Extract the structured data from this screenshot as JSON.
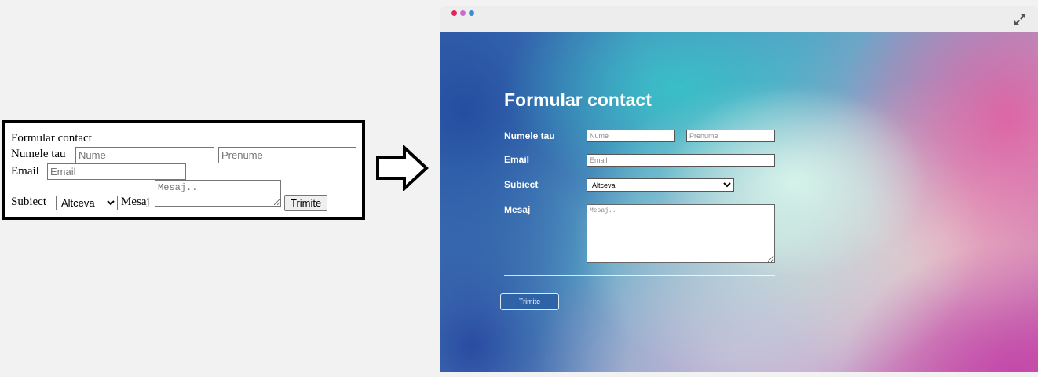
{
  "before": {
    "title": "Formular contact",
    "name_label": "Numele tau",
    "first_name_placeholder": "Nume",
    "last_name_placeholder": "Prenume",
    "email_label": "Email",
    "email_placeholder": "Email",
    "subject_label": "Subiect",
    "subject_selected": "Altceva",
    "message_label": "Mesaj",
    "message_placeholder": "Mesaj..",
    "submit_label": "Trimite"
  },
  "arrow_icon": "right-arrow-icon",
  "window": {
    "traffic_lights": [
      "#e0245e",
      "#c86bd1",
      "#3d8ccb"
    ],
    "expand_icon": "expand-icon"
  },
  "after": {
    "title": "Formular contact",
    "name_label": "Numele tau",
    "first_name_placeholder": "Nume",
    "last_name_placeholder": "Prenume",
    "email_label": "Email",
    "email_placeholder": "Email",
    "subject_label": "Subiect",
    "subject_selected": "Altceva",
    "message_label": "Mesaj",
    "message_placeholder": "Mesaj..",
    "submit_label": "Trimite",
    "button_color": "#2f63a8"
  }
}
